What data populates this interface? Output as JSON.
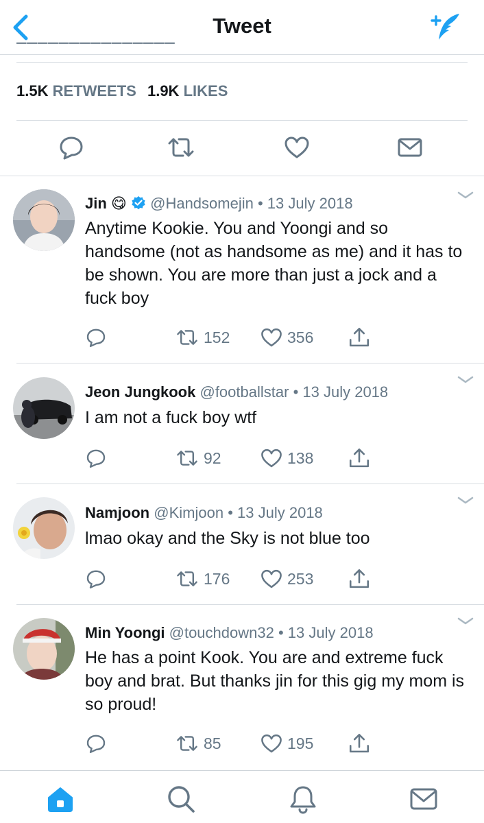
{
  "header": {
    "title": "Tweet",
    "back_icon": "chevron-left-icon",
    "compose_icon": "compose-tweet-icon"
  },
  "tweet_stats": {
    "retweets_count": "1.5K",
    "retweets_label": "RETWEETS",
    "likes_count": "1.9K",
    "likes_label": "LIKES"
  },
  "colors": {
    "accent": "#1da1f2",
    "muted": "#657786",
    "text": "#14171a",
    "divider": "#d8dde2",
    "verified": "#1da1f2"
  },
  "replies": [
    {
      "name": "Jin",
      "emoji": "😋",
      "verified": true,
      "handle": "@Handsomejin",
      "date": "13 July 2018",
      "text": "Anytime Kookie. You and Yoongi and so handsome (not as handsome as me) and it has to be shown. You are more than just a jock and a fuck boy",
      "retweets": "152",
      "likes": "356"
    },
    {
      "name": "Jeon Jungkook",
      "handle": "@footballstar",
      "date": "13 July 2018",
      "text": "I am not a fuck boy wtf",
      "retweets": "92",
      "likes": "138"
    },
    {
      "name": "Namjoon",
      "handle": "@Kimjoon",
      "date": "13 July 2018",
      "text": "lmao okay and the Sky is not blue too",
      "retweets": "176",
      "likes": "253"
    },
    {
      "name": "Min Yoongi",
      "handle": "@touchdown32",
      "date": "13 July 2018",
      "text": "He has a point Kook. You are and extreme fuck boy and brat. But thanks jin for this gig my mom is so proud!",
      "retweets": "85",
      "likes": "195"
    }
  ],
  "meta_separator": "•",
  "tabbar": {
    "home_icon": "home-icon",
    "search_icon": "search-icon",
    "notifications_icon": "bell-icon",
    "messages_icon": "mail-icon"
  }
}
